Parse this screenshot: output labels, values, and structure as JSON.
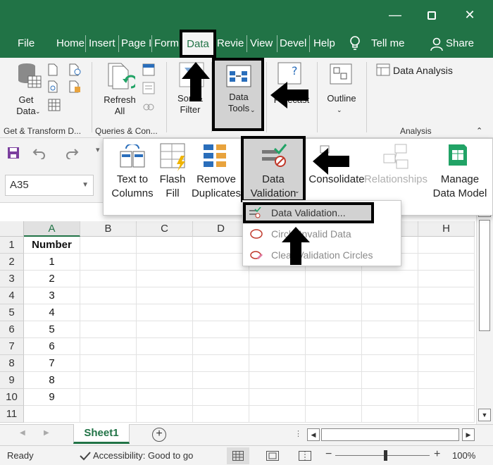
{
  "ribbon_tabs": [
    "File",
    "Home",
    "Insert",
    "Page L",
    "Form",
    "Data",
    "Revie",
    "View",
    "Devel",
    "Help"
  ],
  "tell_me": "Tell me",
  "share": "Share",
  "ribbon": {
    "get_data": "Get\nData",
    "refresh_all": "Refresh\nAll",
    "sort_filter": "Sort &\nFilter",
    "data_tools": "Data\nTools",
    "forecast": "Forecast",
    "outline": "Outline",
    "data_analysis": "Data Analysis",
    "group_get_transform": "Get & Transform D...",
    "group_queries": "Queries & Con...",
    "group_analysis": "Analysis"
  },
  "name_box": "A35",
  "data_tools_popup": {
    "text_to_columns": "Text to\nColumns",
    "flash_fill": "Flash\nFill",
    "remove_duplicates": "Remove\nDuplicates",
    "data_validation": "Data\nValidation",
    "consolidate": "Consolidate",
    "relationships": "Relationships",
    "manage_data_model": "Manage\nData Model"
  },
  "validation_menu": {
    "data_validation": "Data Validation...",
    "circle_invalid": "Circle Invalid Data",
    "clear_circles": "Clear Validation Circles"
  },
  "grid": {
    "columns": [
      "A",
      "B",
      "C",
      "D",
      "E",
      "F",
      "G",
      "H"
    ],
    "rows": [
      [
        "1",
        "Number"
      ],
      [
        "2",
        "1"
      ],
      [
        "3",
        "2"
      ],
      [
        "4",
        "3"
      ],
      [
        "5",
        "4"
      ],
      [
        "6",
        "5"
      ],
      [
        "7",
        "6"
      ],
      [
        "8",
        "7"
      ],
      [
        "9",
        "8"
      ],
      [
        "10",
        "9"
      ],
      [
        "11",
        ""
      ]
    ]
  },
  "sheet_tab": "Sheet1",
  "status": {
    "ready": "Ready",
    "accessibility": "Accessibility: Good to go",
    "zoom": "100%"
  },
  "colors": {
    "accent": "#217346",
    "ribbon": "#f3f3f3"
  }
}
